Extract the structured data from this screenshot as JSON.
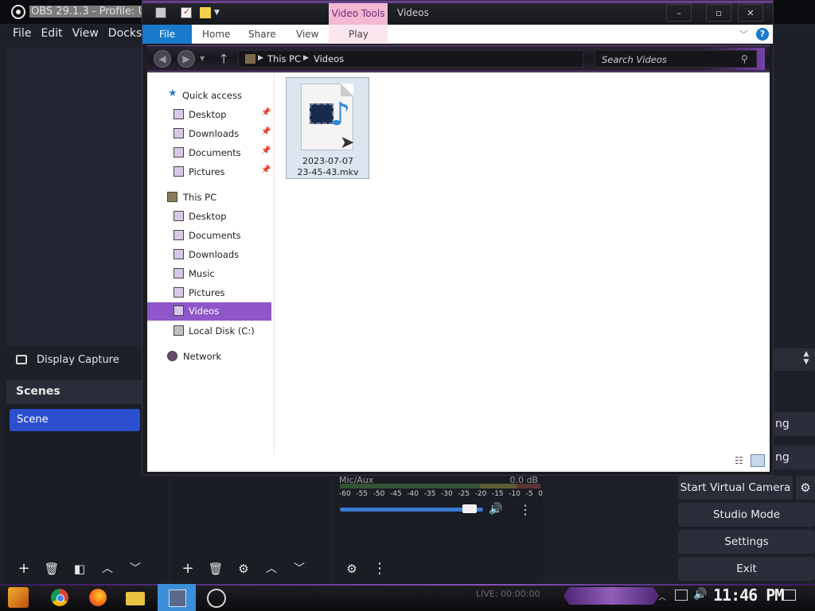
{
  "obs": {
    "title": "OBS 29.1.3 - Profile: Un",
    "menu": [
      "File",
      "Edit",
      "View",
      "Docks"
    ],
    "source_label": "Display Capture",
    "scenes_header": "Scenes",
    "scene_item": "Scene",
    "mixer": {
      "name": "Mic/Aux",
      "db": "0.0 dB",
      "scale": [
        "-60",
        "-55",
        "-50",
        "-45",
        "-40",
        "-35",
        "-30",
        "-25",
        "-20",
        "-15",
        "-10",
        "-5",
        "0"
      ],
      "volume_level": 0.95
    },
    "controls": {
      "partial_1": "ng",
      "partial_2": "ng",
      "virtual_camera": "Start Virtual Camera",
      "studio_mode": "Studio Mode",
      "settings": "Settings",
      "exit": "Exit"
    },
    "toolbar_icons": {
      "add": "+",
      "remove": "🗑",
      "filter": "◧",
      "up": "︿",
      "down": "﹀",
      "gear": "⚙",
      "more": "⋮"
    }
  },
  "explorer": {
    "title": "Videos",
    "contextual_tab": "Video Tools",
    "ribbon_tabs": {
      "file": "File",
      "home": "Home",
      "share": "Share",
      "view": "View",
      "play": "Play"
    },
    "window_buttons": {
      "minimize": "–",
      "maximize": "▫",
      "close": "✕"
    },
    "breadcrumb": [
      "This PC",
      "Videos"
    ],
    "search_placeholder": "Search Videos",
    "nav": {
      "quick_access": "Quick access",
      "quick_items": [
        "Desktop",
        "Downloads",
        "Documents",
        "Pictures"
      ],
      "this_pc": "This PC",
      "pc_items": [
        "Desktop",
        "Documents",
        "Downloads",
        "Music",
        "Pictures",
        "Videos",
        "Local Disk (C:)"
      ],
      "network": "Network",
      "selected": "Videos"
    },
    "file": {
      "name_line1": "2023-07-07",
      "name_line2": "23-45-43.mkv"
    }
  },
  "taskbar": {
    "live": "LIVE: 00:00:00",
    "clock": "11:46 PM"
  }
}
